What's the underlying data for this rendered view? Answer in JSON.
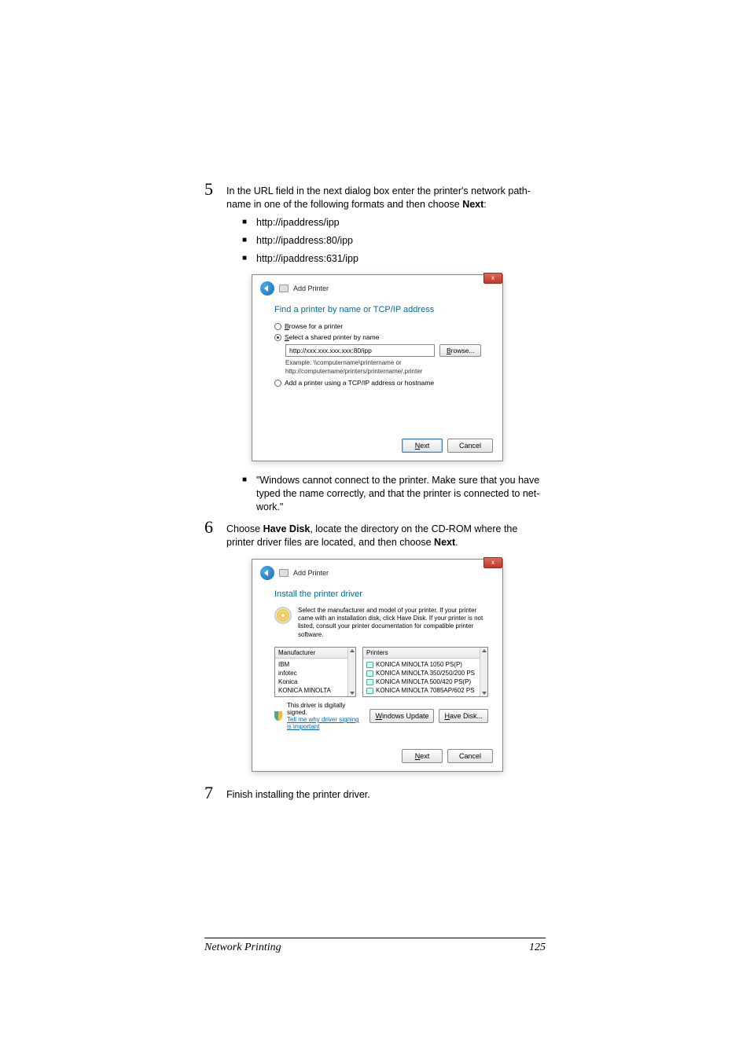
{
  "step5": {
    "num": "5",
    "text_a": "In the URL field in the next dialog box enter the printer's network path­name in one of the following formats and then choose ",
    "text_next": "Next",
    "text_b": ":",
    "bullets": [
      "http://ipaddress/ipp",
      "http://ipaddress:80/ipp",
      "http://ipaddress:631/ipp"
    ]
  },
  "dialog1": {
    "close": "x",
    "title": "Add Printer",
    "heading": "Find a printer by name or TCP/IP address",
    "radio_browse_prefix": "B",
    "radio_browse": "rowse for a printer",
    "radio_select_prefix": "S",
    "radio_select": "elect a shared printer by name",
    "url_value": "http://xxx.xxx.xxx.xxx:80/ipp",
    "browse_btn_prefix": "B",
    "browse_btn": "rowse...",
    "example1": "Example: \\\\computername\\printername or",
    "example2": "http://computername/printers/printername/.printer",
    "radio_tcpip": "Add a printer using a TCP/IP address or hostname",
    "next_prefix": "N",
    "next": "ext",
    "cancel": "Cancel"
  },
  "note": {
    "text": "\"Windows cannot connect to the printer. Make sure that you have typed the name correctly, and that the printer is connected to net­work.\""
  },
  "step6": {
    "num": "6",
    "text_a": "Choose ",
    "havedisk": "Have Disk",
    "text_b": ", locate the directory on the CD-ROM where the printer driver files are located, and then choose ",
    "next": "Next",
    "text_c": "."
  },
  "dialog2": {
    "close": "x",
    "title": "Add Printer",
    "heading": "Install the printer driver",
    "toptext": "Select the manufacturer and model of your printer. If your printer came with an installation disk, click Have Disk. If your printer is not listed, consult your printer documentation for compatible printer software.",
    "mfr_head": "Manufacturer",
    "prn_head": "Printers",
    "mfrs": [
      "IBM",
      "infotec",
      "Konica",
      "KONICA MINOLTA"
    ],
    "printers": [
      "KONICA MINOLTA 1050 PS(P)",
      "KONICA MINOLTA 350/250/200 PS",
      "KONICA MINOLTA 500/420 PS(P)",
      "KONICA MINOLTA 7085AP/602 PS"
    ],
    "signed": "This driver is digitally signed.",
    "tellme": "Tell me why driver signing is important",
    "winupdate_prefix": "W",
    "winupdate": "indows Update",
    "havedisk_prefix": "H",
    "havedisk": "ave Disk...",
    "next_prefix": "N",
    "next": "ext",
    "cancel": "Cancel"
  },
  "step7": {
    "num": "7",
    "text": "Finish installing the printer driver."
  },
  "footer": {
    "left": "Network Printing",
    "right": "125"
  }
}
